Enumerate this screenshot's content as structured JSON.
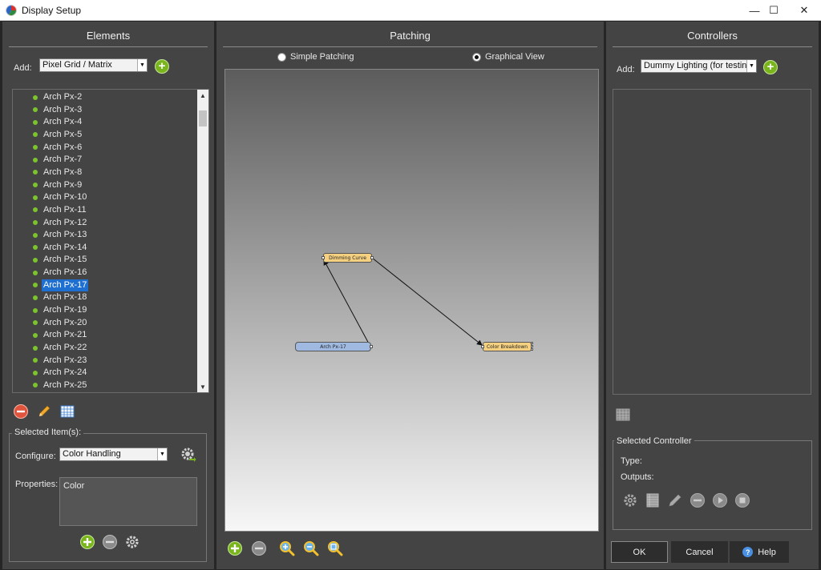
{
  "window": {
    "title": "Display Setup",
    "minimize_glyph": "—",
    "maximize_glyph": "☐",
    "close_glyph": "✕"
  },
  "elements_panel": {
    "title": "Elements",
    "add_label": "Add:",
    "add_type_value": "Pixel Grid / Matrix",
    "tree_items": [
      {
        "label": "Arch Px-2"
      },
      {
        "label": "Arch Px-3"
      },
      {
        "label": "Arch Px-4"
      },
      {
        "label": "Arch Px-5"
      },
      {
        "label": "Arch Px-6"
      },
      {
        "label": "Arch Px-7"
      },
      {
        "label": "Arch Px-8"
      },
      {
        "label": "Arch Px-9"
      },
      {
        "label": "Arch Px-10"
      },
      {
        "label": "Arch Px-11"
      },
      {
        "label": "Arch Px-12"
      },
      {
        "label": "Arch Px-13"
      },
      {
        "label": "Arch Px-14"
      },
      {
        "label": "Arch Px-15"
      },
      {
        "label": "Arch Px-16"
      },
      {
        "label": "Arch Px-17",
        "selected": true
      },
      {
        "label": "Arch Px-18"
      },
      {
        "label": "Arch Px-19"
      },
      {
        "label": "Arch Px-20"
      },
      {
        "label": "Arch Px-21"
      },
      {
        "label": "Arch Px-22"
      },
      {
        "label": "Arch Px-23"
      },
      {
        "label": "Arch Px-24"
      },
      {
        "label": "Arch Px-25"
      }
    ],
    "selected_group": {
      "title": "Selected Item(s):",
      "configure_label": "Configure:",
      "configure_value": "Color Handling",
      "properties_label": "Properties:",
      "properties_items": [
        "Color"
      ]
    }
  },
  "patching_panel": {
    "title": "Patching",
    "mode_simple": "Simple Patching",
    "mode_graphical": "Graphical View",
    "selected_mode": "graphical",
    "nodes": {
      "dimming_curve": "Dimming Curve",
      "color_breakdown": "Color Breakdown",
      "element": "Arch Px-17"
    }
  },
  "controllers_panel": {
    "title": "Controllers",
    "add_label": "Add:",
    "add_type_value": "Dummy Lighting (for testing)",
    "selected_group": {
      "title": "Selected Controller",
      "type_label": "Type:",
      "outputs_label": "Outputs:"
    }
  },
  "footer": {
    "ok_label": "OK",
    "cancel_label": "Cancel",
    "help_label": "Help"
  },
  "colors": {
    "accent_green": "#7ab51d",
    "selection_blue": "#1e6fd0",
    "remove_red": "#e0533d",
    "panel_bg": "#444444"
  }
}
